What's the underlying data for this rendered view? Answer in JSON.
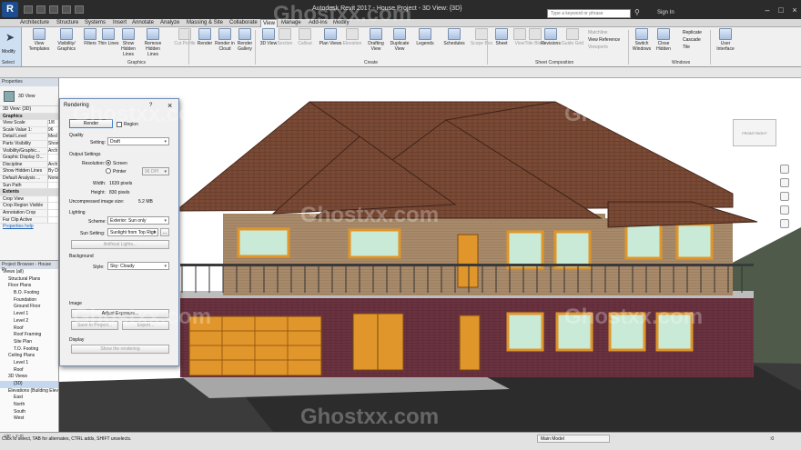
{
  "titlebar": {
    "app_title": "Autodesk Revit 2017 -",
    "doc_title": "House Project - 3D View: {3D}",
    "search_placeholder": "Type a keyword or phrase",
    "sign_in": "Sign In"
  },
  "tabs": [
    "Architecture",
    "Structure",
    "Systems",
    "Insert",
    "Annotate",
    "Analyze",
    "Massing & Site",
    "Collaborate",
    "View",
    "Manage",
    "Add-Ins",
    "Modify"
  ],
  "active_tab": "View",
  "ribbon": {
    "modify": "Modify",
    "tools": [
      {
        "label": "View Templates",
        "icon": "view-templates-icon",
        "enabled": true
      },
      {
        "label": "Visibility/ Graphics",
        "icon": "visibility-graphics-icon",
        "enabled": true
      },
      {
        "label": "Filters",
        "icon": "filters-icon",
        "enabled": true
      },
      {
        "label": "Thin Lines",
        "icon": "thin-lines-icon",
        "enabled": true
      },
      {
        "label": "Show Hidden Lines",
        "icon": "show-hidden-lines-icon",
        "enabled": true
      },
      {
        "label": "Remove Hidden Lines",
        "icon": "remove-hidden-lines-icon",
        "enabled": true
      },
      {
        "label": "Cut Profile",
        "icon": "cut-profile-icon",
        "enabled": false
      },
      {
        "label": "Render",
        "icon": "render-icon",
        "enabled": true
      },
      {
        "label": "Render in Cloud",
        "icon": "render-cloud-icon",
        "enabled": true
      },
      {
        "label": "Render Gallery",
        "icon": "render-gallery-icon",
        "enabled": true
      },
      {
        "label": "3D View",
        "icon": "3d-view-icon",
        "enabled": true
      },
      {
        "label": "Section",
        "icon": "section-icon",
        "enabled": false
      },
      {
        "label": "Callout",
        "icon": "callout-icon",
        "enabled": false
      },
      {
        "label": "Plan Views",
        "icon": "plan-views-icon",
        "enabled": true
      },
      {
        "label": "Elevation",
        "icon": "elevation-icon",
        "enabled": false
      },
      {
        "label": "Drafting View",
        "icon": "drafting-view-icon",
        "enabled": true
      },
      {
        "label": "Duplicate View",
        "icon": "duplicate-view-icon",
        "enabled": true
      },
      {
        "label": "Legends",
        "icon": "legends-icon",
        "enabled": true
      },
      {
        "label": "Schedules",
        "icon": "schedules-icon",
        "enabled": true
      },
      {
        "label": "Scope Box",
        "icon": "scope-box-icon",
        "enabled": false
      },
      {
        "label": "Sheet",
        "icon": "sheet-icon",
        "enabled": true
      },
      {
        "label": "View",
        "icon": "view-icon",
        "enabled": false
      },
      {
        "label": "Title Block",
        "icon": "title-block-icon",
        "enabled": false
      },
      {
        "label": "Revisions",
        "icon": "revisions-icon",
        "enabled": true
      },
      {
        "label": "Guide Grid",
        "icon": "guide-grid-icon",
        "enabled": false
      },
      {
        "label": "Switch Windows",
        "icon": "switch-windows-icon",
        "enabled": true
      },
      {
        "label": "Close Hidden",
        "icon": "close-hidden-icon",
        "enabled": true
      },
      {
        "label": "User Interface",
        "icon": "user-interface-icon",
        "enabled": true
      }
    ],
    "small_tools": [
      "Matchline",
      "View Reference",
      "Viewports"
    ],
    "window_tools": [
      "Replicate",
      "Cascade",
      "Tile"
    ],
    "panels": {
      "graphics": "Graphics",
      "create": "Create",
      "sheet": "Sheet Composition",
      "windows": "Windows",
      "select": "Select"
    }
  },
  "properties": {
    "header": "Properties",
    "type": "3D View",
    "instance": "3D View: {3D}",
    "rows": [
      {
        "label": "Graphics",
        "value": "",
        "section": true
      },
      {
        "label": "View Scale",
        "value": "1/8"
      },
      {
        "label": "Scale Value   1:",
        "value": "96"
      },
      {
        "label": "Detail Level",
        "value": "Med"
      },
      {
        "label": "Parts Visibility",
        "value": "Show"
      },
      {
        "label": "Visibility/Graphic...",
        "value": "Arch"
      },
      {
        "label": "Graphic Display O...",
        "value": ""
      },
      {
        "label": "Discipline",
        "value": "Arch"
      },
      {
        "label": "Show Hidden Lines",
        "value": "By D"
      },
      {
        "label": "Default Analysis ...",
        "value": "None"
      },
      {
        "label": "Sun Path",
        "value": ""
      },
      {
        "label": "Extents",
        "value": "",
        "section": true
      },
      {
        "label": "Crop View",
        "value": ""
      },
      {
        "label": "Crop Region Visible",
        "value": ""
      },
      {
        "label": "Annotation Crop",
        "value": ""
      },
      {
        "label": "Far Clip Active",
        "value": ""
      }
    ],
    "help": "Properties help"
  },
  "browser": {
    "header": "Project Browser - House Pr",
    "items": [
      {
        "label": "Views (all)",
        "level": 0
      },
      {
        "label": "Structural Plans",
        "level": 1
      },
      {
        "label": "Floor Plans",
        "level": 1
      },
      {
        "label": "B.O. Footing",
        "level": 2
      },
      {
        "label": "Foundation",
        "level": 2
      },
      {
        "label": "Ground Floor",
        "level": 2
      },
      {
        "label": "Level 1",
        "level": 2
      },
      {
        "label": "Level 2",
        "level": 2
      },
      {
        "label": "Roof",
        "level": 2
      },
      {
        "label": "Roof Framing",
        "level": 2
      },
      {
        "label": "Site Plan",
        "level": 2
      },
      {
        "label": "T.O. Footing",
        "level": 2
      },
      {
        "label": "Ceiling Plans",
        "level": 1
      },
      {
        "label": "Level 1",
        "level": 2
      },
      {
        "label": "Roof",
        "level": 2
      },
      {
        "label": "3D Views",
        "level": 1
      },
      {
        "label": "{3D}",
        "level": 2,
        "selected": true
      },
      {
        "label": "Elevations (Building Elevation)",
        "level": 1
      },
      {
        "label": "East",
        "level": 2
      },
      {
        "label": "North",
        "level": 2
      },
      {
        "label": "South",
        "level": 2
      },
      {
        "label": "West",
        "level": 2
      }
    ]
  },
  "dialog": {
    "title": "Rendering",
    "help": "?",
    "render": "Render",
    "region": "Region",
    "quality_group": "Quality",
    "setting_label": "Setting:",
    "setting_value": "Draft",
    "output_group": "Output Settings",
    "resolution_label": "Resolution:",
    "screen": "Screen",
    "printer": "Printer",
    "dpi": "96 DPI",
    "width_label": "Width:",
    "width_value": "1639 pixels",
    "height_label": "Height:",
    "height_value": "830 pixels",
    "size_label": "Uncompressed image size:",
    "size_value": "5.2 MB",
    "lighting_group": "Lighting",
    "scheme_label": "Scheme:",
    "scheme_value": "Exterior: Sun only",
    "sun_label": "Sun Setting:",
    "sun_value": "Sunlight from Top Righ",
    "artificial": "Artificial Lights...",
    "background_group": "Background",
    "style_label": "Style:",
    "style_value": "Sky: Cloudy",
    "image_group": "Image",
    "adjust": "Adjust Exposure...",
    "save": "Save to Project...",
    "export": "Export...",
    "display_group": "Display",
    "show": "Show the rendering"
  },
  "viewcube": {
    "label": "FRONT RIGHT"
  },
  "view_control": {
    "scale": "1/8\" = 1'-0\""
  },
  "status": {
    "text": "Click to select, TAB for alternates, CTRL adds, SHIFT unselects.",
    "model": "Main Model",
    "zoom": ":0"
  },
  "watermark": "Ghostxx.com",
  "colors": {
    "roof": "#7a4a35",
    "brick": "#6b3340",
    "siding": "#a88a6a",
    "trim": "#e0962a",
    "glass": "#c8ead6",
    "deck": "#b0b0b0"
  }
}
